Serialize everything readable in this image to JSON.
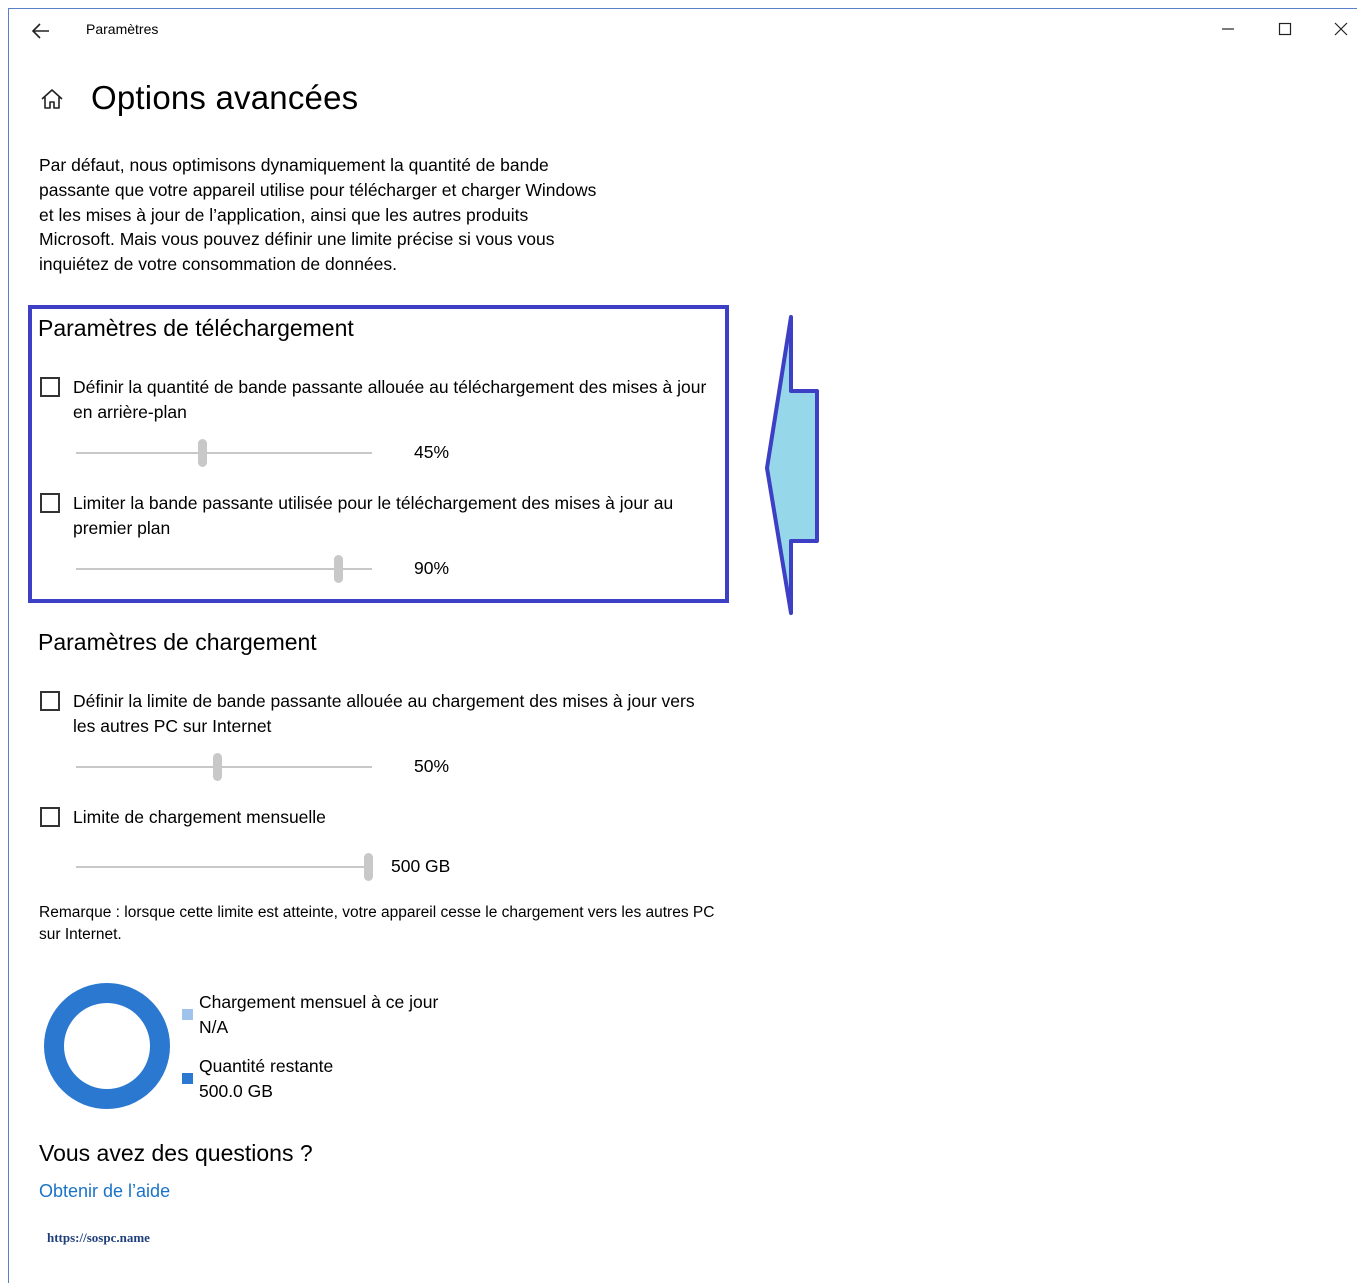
{
  "window": {
    "title": "Paramètres",
    "controls": [
      "minimize-icon",
      "maximize-icon",
      "close-icon"
    ]
  },
  "page": {
    "title": "Options avancées",
    "home_icon": "home-icon",
    "intro": "Par défaut, nous optimisons dynamiquement la quantité de bande passante que votre appareil utilise pour télécharger et charger Windows et les mises à jour de l’application, ainsi que les autres produits Microsoft. Mais vous pouvez définir une limite précise si vous vous inquiétez de votre consommation de données."
  },
  "download": {
    "title": "Paramètres de téléchargement",
    "options": [
      {
        "label": "Définir la quantité de bande passante allouée au téléchargement des mises à jour en arrière-plan",
        "checked": false,
        "value_label": "45%",
        "level": 0.45
      },
      {
        "label": "Limiter la bande passante utilisée pour le téléchargement des mises à jour au premier plan",
        "checked": false,
        "value_label": "90%",
        "level": 0.9
      }
    ]
  },
  "upload": {
    "title": "Paramètres de chargement",
    "options": [
      {
        "label": "Définir la limite de bande passante allouée au chargement des mises à jour vers les autres PC sur Internet",
        "checked": false,
        "value_label": "50%",
        "level": 0.5
      },
      {
        "label": "Limite de chargement mensuelle",
        "checked": false,
        "value_label": "500 GB",
        "level": 1.0
      }
    ],
    "note": "Remarque : lorsque cette limite est atteinte, votre appareil cesse le chargement vers les autres PC sur Internet."
  },
  "usage": {
    "legend": [
      {
        "label": "Chargement mensuel à ce jour",
        "value": "N/A",
        "color": "#9fc3ea"
      },
      {
        "label": "Quantité restante",
        "value": "500.0 GB",
        "color": "#2a78d0"
      }
    ]
  },
  "help": {
    "title": "Vous avez des questions ?",
    "link": "Obtenir de l’aide"
  },
  "watermark": "https://sospc.name",
  "colors": {
    "highlight_border": "#3d3fc4",
    "arrow_fill": "#96d8ea",
    "link": "#1a73c8",
    "slider": "#c8c8c8"
  }
}
